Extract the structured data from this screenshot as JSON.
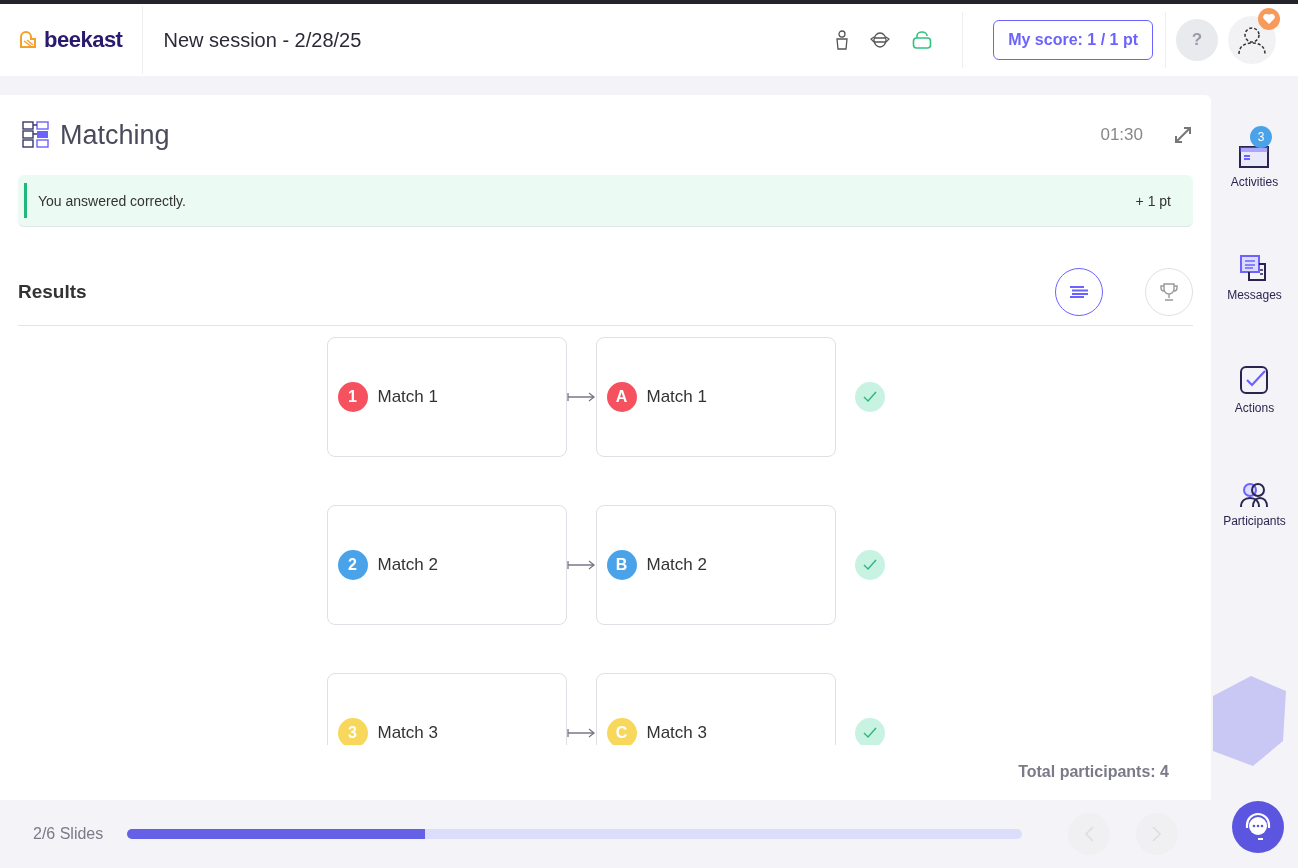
{
  "header": {
    "logo": "beekast",
    "session_title": "New session - 2/28/25",
    "score_button": "My score: 1 / 1 pt",
    "help_button": "?"
  },
  "activity": {
    "title": "Matching",
    "timer": "01:30",
    "feedback": {
      "message": "You answered correctly.",
      "points": "+ 1 pt"
    },
    "results_title": "Results",
    "views": [
      {
        "kind": "list",
        "selected": true
      },
      {
        "kind": "ranking",
        "selected": false
      }
    ],
    "pairs": [
      {
        "left_marker": "1",
        "left_label": "Match 1",
        "right_marker": "A",
        "right_label": "Match 1",
        "color": "#f5515f",
        "correct": true
      },
      {
        "left_marker": "2",
        "left_label": "Match 2",
        "right_marker": "B",
        "right_label": "Match 2",
        "color": "#4aa3e8",
        "correct": true
      },
      {
        "left_marker": "3",
        "left_label": "Match 3",
        "right_marker": "C",
        "right_label": "Match 3",
        "color": "#f7d85c",
        "correct": true
      }
    ],
    "total_participants": "Total participants: 4"
  },
  "sidebar": {
    "items": [
      {
        "kind": "activities",
        "label": "Activities",
        "badge": "3"
      },
      {
        "kind": "messages",
        "label": "Messages"
      },
      {
        "kind": "actions",
        "label": "Actions"
      },
      {
        "kind": "participants",
        "label": "Participants"
      }
    ]
  },
  "footer": {
    "slides": "2/6 Slides",
    "progress": {
      "level": 0.333
    }
  }
}
